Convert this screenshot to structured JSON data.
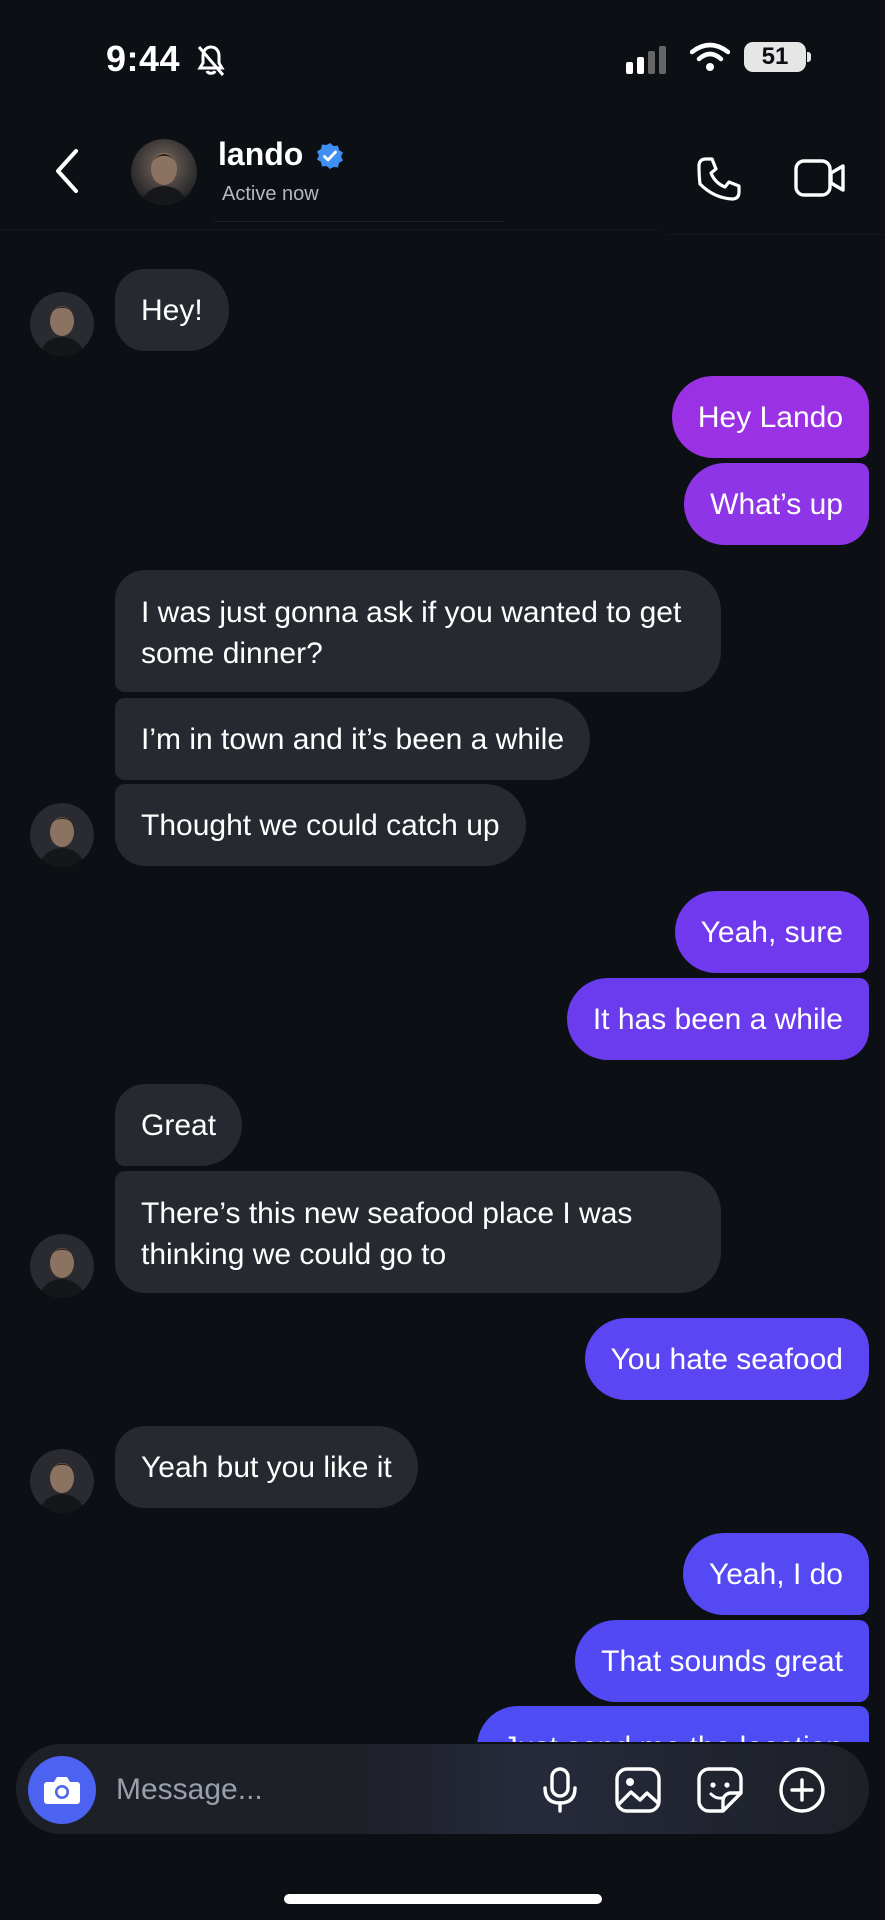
{
  "status_bar": {
    "time": "9:44",
    "battery": "51"
  },
  "header": {
    "name": "lando",
    "status": "Active now",
    "icons": [
      "back-chevron-icon",
      "verified-badge-icon",
      "phone-icon",
      "video-camera-icon"
    ]
  },
  "messages": [
    {
      "side": "in",
      "text": "Hey!"
    },
    {
      "side": "out",
      "text": "Hey Lando"
    },
    {
      "side": "out",
      "text": "What’s up"
    },
    {
      "side": "in",
      "text": "I was just gonna ask if you wanted to get some dinner?"
    },
    {
      "side": "in",
      "text": "I’m in town and it’s been a while"
    },
    {
      "side": "in",
      "text": "Thought we could catch up"
    },
    {
      "side": "out",
      "text": "Yeah, sure"
    },
    {
      "side": "out",
      "text": "It has been a while"
    },
    {
      "side": "in",
      "text": "Great"
    },
    {
      "side": "in",
      "text": "There’s this new seafood place I was thinking we could go to"
    },
    {
      "side": "out",
      "text": "You hate seafood"
    },
    {
      "side": "in",
      "text": "Yeah but you like it"
    },
    {
      "side": "out",
      "text": "Yeah, I do"
    },
    {
      "side": "out",
      "text": "That sounds great"
    },
    {
      "side": "out",
      "text": "Just send me the location"
    }
  ],
  "composer": {
    "placeholder": "Message...",
    "icons": [
      "camera-icon",
      "microphone-icon",
      "gallery-icon",
      "sticker-icon",
      "add-circle-icon"
    ]
  },
  "colors": {
    "background": "#0c0f14",
    "incoming_bubble": "#26292f",
    "outgoing_purple": "#9a32e6",
    "outgoing_indigo": "#5a48f2",
    "accent_blue": "#4b63f0"
  }
}
